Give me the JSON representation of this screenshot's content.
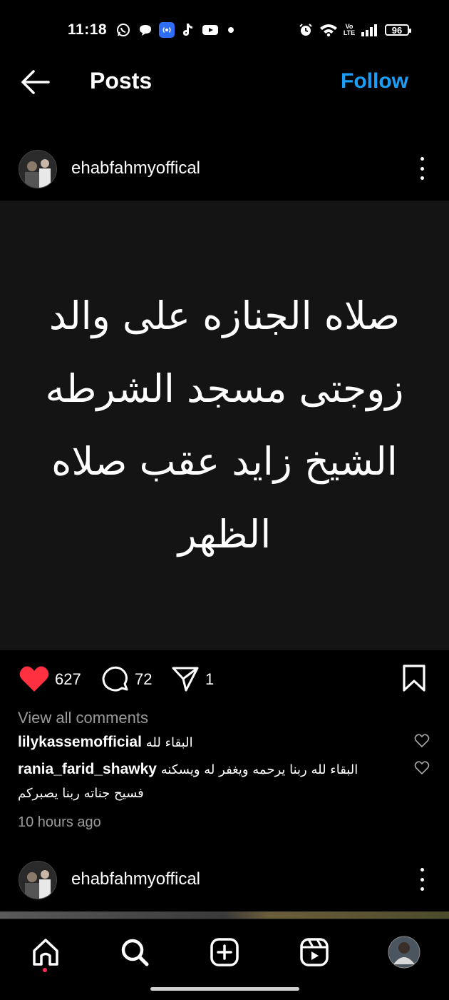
{
  "status_bar": {
    "time": "11:18",
    "battery": "96",
    "icons": [
      "whatsapp-icon",
      "chat-bubble-icon",
      "radio-broadcast-icon",
      "tiktok-icon",
      "youtube-icon",
      "dot-icon",
      "alarm-icon",
      "wifi-icon",
      "volte-icon",
      "signal-icon",
      "battery-icon"
    ]
  },
  "header": {
    "title": "Posts",
    "follow_label": "Follow",
    "accent_color": "#1a9ef7"
  },
  "post": {
    "username": "ehabfahmyoffical",
    "text_lines": [
      "صلاه الجنازه على والد",
      "زوجتى مسجد الشرطه",
      "الشيخ زايد عقب صلاه",
      "الظهر"
    ],
    "likes": "627",
    "comments_count": "72",
    "shares": "1",
    "view_all_comments": "View all comments",
    "comments": [
      {
        "user": "lilykassemofficial",
        "text": "البقاء لله"
      },
      {
        "user": "rania_farid_shawky",
        "text": "البقاء لله ربنا يرحمه ويغفر له ويسكنه",
        "text_cont": "فسيح جناته ربنا يصبركم"
      }
    ],
    "time_ago": "10 hours ago"
  },
  "next_post": {
    "username": "ehabfahmyoffical"
  },
  "bottom_nav": {
    "items": [
      "home-icon",
      "search-icon",
      "create-icon",
      "reels-icon",
      "profile-avatar"
    ],
    "notification_color": "#ff2a55"
  }
}
